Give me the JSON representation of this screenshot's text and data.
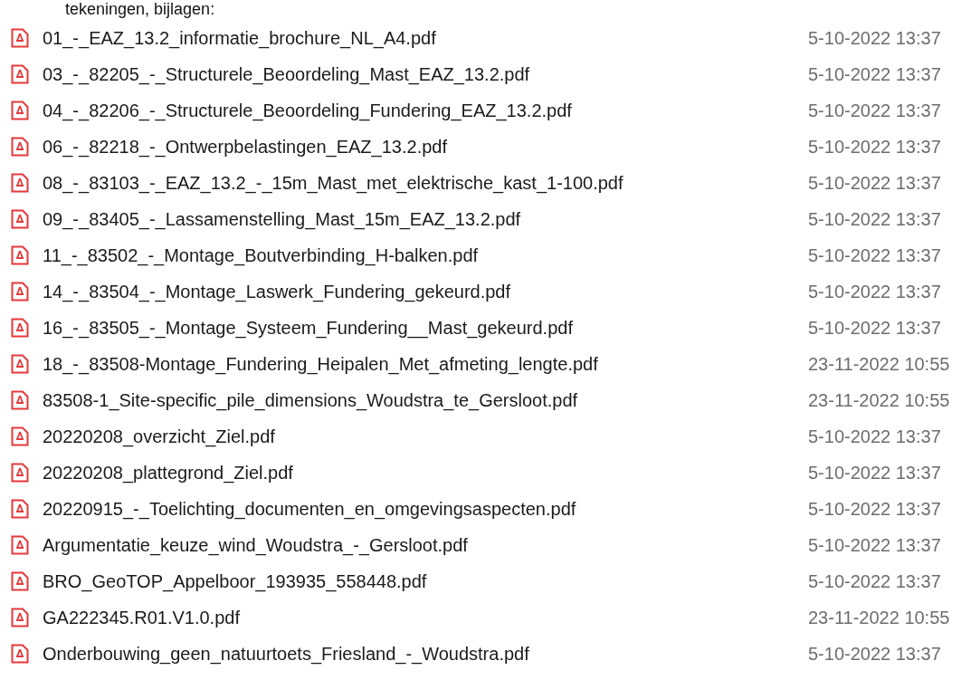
{
  "heading": "tekeningen, bijlagen:",
  "files": [
    {
      "name": "01_-_EAZ_13.2_informatie_brochure_NL_A4.pdf",
      "modified": "5-10-2022 13:37"
    },
    {
      "name": "03_-_82205_-_Structurele_Beoordeling_Mast_EAZ_13.2.pdf",
      "modified": "5-10-2022 13:37"
    },
    {
      "name": "04_-_82206_-_Structurele_Beoordeling_Fundering_EAZ_13.2.pdf",
      "modified": "5-10-2022 13:37"
    },
    {
      "name": "06_-_82218_-_Ontwerpbelastingen_EAZ_13.2.pdf",
      "modified": "5-10-2022 13:37"
    },
    {
      "name": "08_-_83103_-_EAZ_13.2_-_15m_Mast_met_elektrische_kast_1-100.pdf",
      "modified": "5-10-2022 13:37"
    },
    {
      "name": "09_-_83405_-_Lassamenstelling_Mast_15m_EAZ_13.2.pdf",
      "modified": "5-10-2022 13:37"
    },
    {
      "name": "11_-_83502_-_Montage_Boutverbinding_H-balken.pdf",
      "modified": "5-10-2022 13:37"
    },
    {
      "name": "14_-_83504_-_Montage_Laswerk_Fundering_gekeurd.pdf",
      "modified": "5-10-2022 13:37"
    },
    {
      "name": "16_-_83505_-_Montage_Systeem_Fundering__Mast_gekeurd.pdf",
      "modified": "5-10-2022 13:37"
    },
    {
      "name": "18_-_83508-Montage_Fundering_Heipalen_Met_afmeting_lengte.pdf",
      "modified": "23-11-2022 10:55"
    },
    {
      "name": "83508-1_Site-specific_pile_dimensions_Woudstra_te_Gersloot.pdf",
      "modified": "23-11-2022 10:55"
    },
    {
      "name": "20220208_overzicht_Ziel.pdf",
      "modified": "5-10-2022 13:37"
    },
    {
      "name": "20220208_plattegrond_Ziel.pdf",
      "modified": "5-10-2022 13:37"
    },
    {
      "name": "20220915_-_Toelichting_documenten_en_omgevingsaspecten.pdf",
      "modified": "5-10-2022 13:37"
    },
    {
      "name": "Argumentatie_keuze_wind_Woudstra_-_Gersloot.pdf",
      "modified": "5-10-2022 13:37"
    },
    {
      "name": "BRO_GeoTOP_Appelboor_193935_558448.pdf",
      "modified": "5-10-2022 13:37"
    },
    {
      "name": "GA222345.R01.V1.0.pdf",
      "modified": "23-11-2022 10:55"
    },
    {
      "name": "Onderbouwing_geen_natuurtoets_Friesland_-_Woudstra.pdf",
      "modified": "5-10-2022 13:37"
    }
  ]
}
